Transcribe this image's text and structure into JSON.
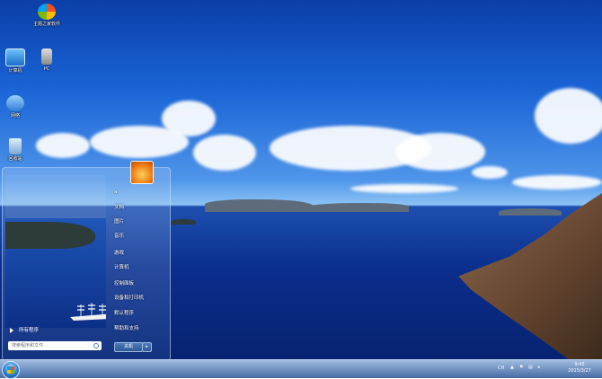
{
  "desktop": {
    "icons": [
      {
        "label": "主题之家软件",
        "icon": "theme-home-software-icon"
      },
      {
        "label": "计算机",
        "icon": "computer-icon"
      },
      {
        "label": "PC",
        "icon": "pc-icon"
      },
      {
        "label": "网络",
        "icon": "network-icon"
      },
      {
        "label": "回收站",
        "icon": "recycle-bin-icon"
      }
    ]
  },
  "start_menu": {
    "user_tile_icon": "flower-user-picture-icon",
    "right_items": [
      {
        "label": "a"
      },
      {
        "label": "文档"
      },
      {
        "label": "图片"
      },
      {
        "label": "音乐"
      },
      {
        "label": "游戏"
      },
      {
        "label": "计算机"
      },
      {
        "label": "控制面板"
      },
      {
        "label": "设备和打印机"
      },
      {
        "label": "默认程序"
      },
      {
        "label": "帮助和支持"
      }
    ],
    "all_programs": "所有程序",
    "search_placeholder": "搜索程序和文件",
    "shutdown": "关机",
    "shutdown_arrow": "▸"
  },
  "taskbar": {
    "tray_lang": "CH",
    "time": "9:43",
    "date": "2015/3/27",
    "accent": "#2c7fd1"
  }
}
